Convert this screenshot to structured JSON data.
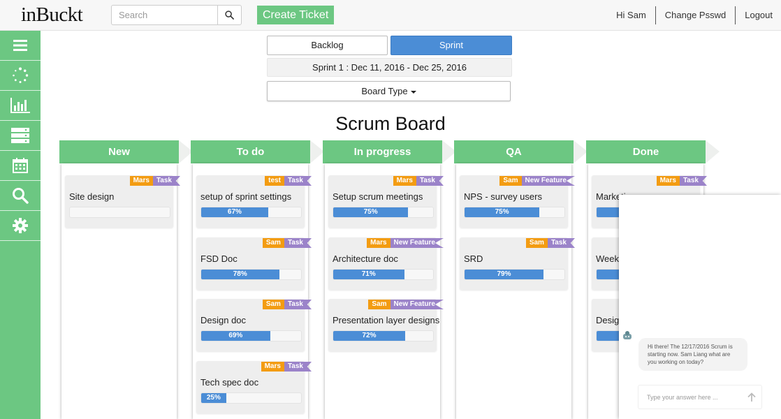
{
  "header": {
    "logo": "inBuckt",
    "search_placeholder": "Search",
    "create_label": "Create Ticket",
    "greeting": "Hi Sam",
    "change_password": "Change Psswd",
    "logout": "Logout"
  },
  "sidebar": {
    "items": [
      {
        "icon": "list-icon"
      },
      {
        "icon": "spinner-icon"
      },
      {
        "icon": "bar-chart-icon"
      },
      {
        "icon": "server-icon"
      },
      {
        "icon": "calendar-icon"
      },
      {
        "icon": "search-icon"
      },
      {
        "icon": "gear-icon"
      }
    ]
  },
  "controls": {
    "backlog": "Backlog",
    "sprint": "Sprint",
    "sprint_label": "Sprint 1 : Dec 11, 2016 - Dec 25, 2016",
    "board_type": "Board Type"
  },
  "board": {
    "title": "Scrum Board",
    "columns": [
      {
        "name": "New",
        "cards": [
          {
            "owner": "Mars",
            "type": "Task",
            "title": "Site design",
            "progress": 0,
            "progress_label": ""
          }
        ]
      },
      {
        "name": "To do",
        "cards": [
          {
            "owner": "test",
            "type": "Task",
            "title": "setup of sprint settings",
            "progress": 67,
            "progress_label": "67%"
          },
          {
            "owner": "Sam",
            "type": "Task",
            "title": "FSD Doc",
            "progress": 78,
            "progress_label": "78%"
          },
          {
            "owner": "Sam",
            "type": "Task",
            "title": "Design doc",
            "progress": 69,
            "progress_label": "69%"
          },
          {
            "owner": "Mars",
            "type": "Task",
            "title": "Tech spec doc",
            "progress": 25,
            "progress_label": "25%"
          }
        ]
      },
      {
        "name": "In progress",
        "cards": [
          {
            "owner": "Mars",
            "type": "Task",
            "title": "Setup scrum meetings",
            "progress": 75,
            "progress_label": "75%"
          },
          {
            "owner": "Mars",
            "type": "New Feature",
            "title": "Architecture doc",
            "progress": 71,
            "progress_label": "71%"
          },
          {
            "owner": "Sam",
            "type": "New Feature",
            "title": "Presentation layer designs",
            "progress": 72,
            "progress_label": "72%"
          }
        ]
      },
      {
        "name": "QA",
        "cards": [
          {
            "owner": "Sam",
            "type": "New Feature",
            "title": "NPS - survey users",
            "progress": 75,
            "progress_label": "75%"
          },
          {
            "owner": "Sam",
            "type": "Task",
            "title": "SRD",
            "progress": 79,
            "progress_label": "79%"
          }
        ]
      },
      {
        "name": "Done",
        "cards": [
          {
            "owner": "Mars",
            "type": "Task",
            "title": "Marketi",
            "progress": 75,
            "progress_label": ""
          },
          {
            "owner": "",
            "type": "",
            "title": "Weekly",
            "progress": 75,
            "progress_label": ""
          },
          {
            "owner": "",
            "type": "",
            "title": "Design",
            "progress": 75,
            "progress_label": ""
          }
        ]
      }
    ]
  },
  "chat": {
    "message": "Hi there! The 12/17/2016 Scrum is starting now. Sam Liang what are you working on today?",
    "input_placeholder": "Type your answer here ..."
  }
}
